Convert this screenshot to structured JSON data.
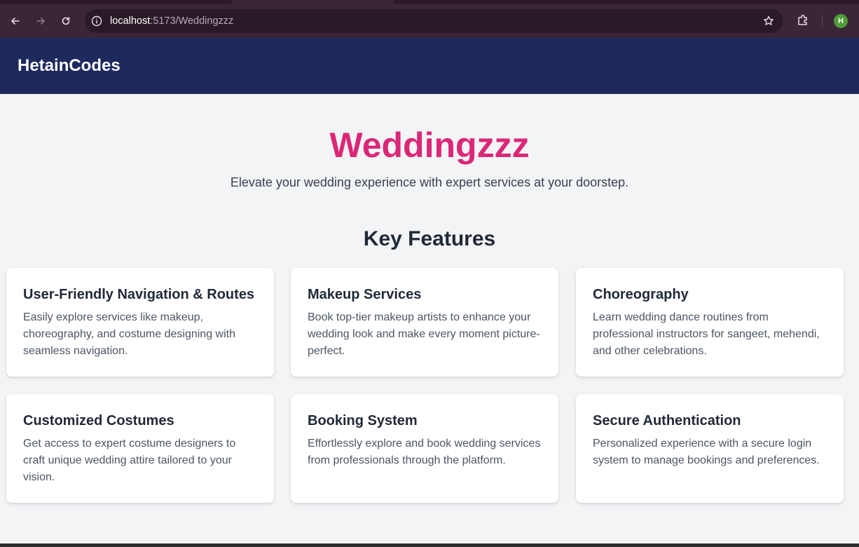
{
  "browser": {
    "url_host": "localhost",
    "url_path": ":5173/Weddingzzz",
    "avatar_initial": "H"
  },
  "header": {
    "brand": "HetainCodes"
  },
  "hero": {
    "title": "Weddingzzz",
    "subtitle": "Elevate your wedding experience with expert services at your doorstep."
  },
  "features": {
    "title": "Key Features",
    "items": [
      {
        "title": "User-Friendly Navigation & Routes",
        "description": "Easily explore services like makeup, choreography, and costume designing with seamless navigation."
      },
      {
        "title": "Makeup Services",
        "description": "Book top-tier makeup artists to enhance your wedding look and make every moment picture-perfect."
      },
      {
        "title": "Choreography",
        "description": "Learn wedding dance routines from professional instructors for sangeet, mehendi, and other celebrations."
      },
      {
        "title": "Customized Costumes",
        "description": "Get access to expert costume designers to craft unique wedding attire tailored to your vision."
      },
      {
        "title": "Booking System",
        "description": "Effortlessly explore and book wedding services from professionals through the platform."
      },
      {
        "title": "Secure Authentication",
        "description": "Personalized experience with a secure login system to manage bookings and preferences."
      }
    ]
  },
  "colors": {
    "header_bg": "#1e2a5e",
    "accent": "#db2777",
    "page_bg": "#f3f4f6"
  },
  "icons": [
    "back-arrow-icon",
    "forward-arrow-icon",
    "reload-icon",
    "site-info-icon",
    "bookmark-star-icon",
    "extensions-icon"
  ]
}
